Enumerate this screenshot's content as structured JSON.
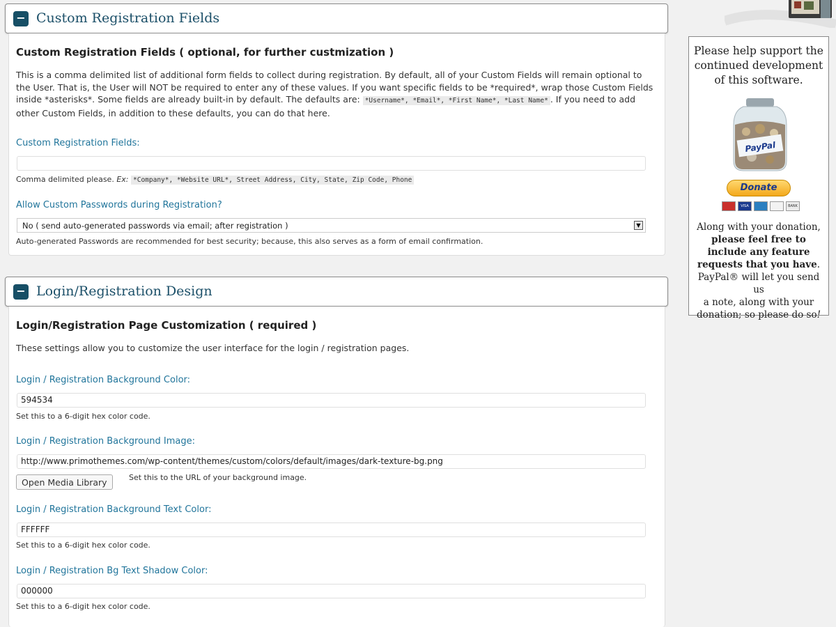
{
  "section1": {
    "toggle": "−",
    "title": "Custom Registration Fields",
    "heading": "Custom Registration Fields ( optional, for further custmization )",
    "desc_part1": "This is a comma delimited list of additional form fields to collect during registration. By default, all of your Custom Fields will remain optional to the User. That is, the User will NOT be required to enter any of these values. If you want specific fields to be *required*, wrap those Custom Fields inside *asterisks*. Some fields are already built-in by default. The defaults are: ",
    "defaults_code": "*Username*, *Email*, *First Name*, *Last Name*",
    "desc_part2": ". If you need to add other Custom Fields, in addition to these defaults, you can do that here.",
    "fields_label": "Custom Registration Fields:",
    "fields_value": "",
    "fields_note": "Comma delimited please.",
    "fields_note_ex": "Ex:",
    "fields_note_code": "*Company*, *Website URL*, Street Address, City, State, Zip Code, Phone",
    "passwords_label": "Allow Custom Passwords during Registration?",
    "passwords_selected": "No ( send auto-generated passwords via email; after registration )",
    "passwords_note": "Auto-generated Passwords are recommended for best security; because, this also serves as a form of email confirmation."
  },
  "section2": {
    "toggle": "−",
    "title": "Login/Registration Design",
    "heading": "Login/Registration Page Customization ( required )",
    "desc": "These settings allow you to customize the user interface for the login / registration pages.",
    "bg_color_label": "Login / Registration Background Color:",
    "bg_color_value": "594534",
    "bg_color_note": "Set this to a 6-digit hex color code.",
    "bg_image_label": "Login / Registration Background Image:",
    "bg_image_value": "http://www.primothemes.com/wp-content/themes/custom/colors/default/images/dark-texture-bg.png",
    "media_button": "Open Media Library",
    "bg_image_note": "Set this to the URL of your background image.",
    "text_color_label": "Login / Registration Background Text Color:",
    "text_color_value": "FFFFFF",
    "text_color_note": "Set this to a 6-digit hex color code.",
    "shadow_label": "Login / Registration Bg Text Shadow Color:",
    "shadow_value": "000000",
    "shadow_note": "Set this to a 6-digit hex color code."
  },
  "sidebar": {
    "support_line1": "Please help support the",
    "support_line2": "continued development",
    "support_line3": "of this software.",
    "jar_label": "PayPal",
    "donate_button": "Donate",
    "cards": [
      "",
      "VISA",
      "",
      "",
      "BANK"
    ],
    "foot_line1": "Along with your donation,",
    "foot_bold1": "please feel free to",
    "foot_bold2": "include any feature",
    "foot_bold3": "requests that you have",
    "foot_period": ".",
    "foot_line3": "PayPal® will let you send us",
    "foot_line4": "a note, along with your",
    "foot_line5": "donation; so please do so",
    "foot_end": "!"
  },
  "colors": {
    "toggle_bg": "#174f66",
    "title_text": "#1b4f68",
    "label_text": "#21759b"
  }
}
